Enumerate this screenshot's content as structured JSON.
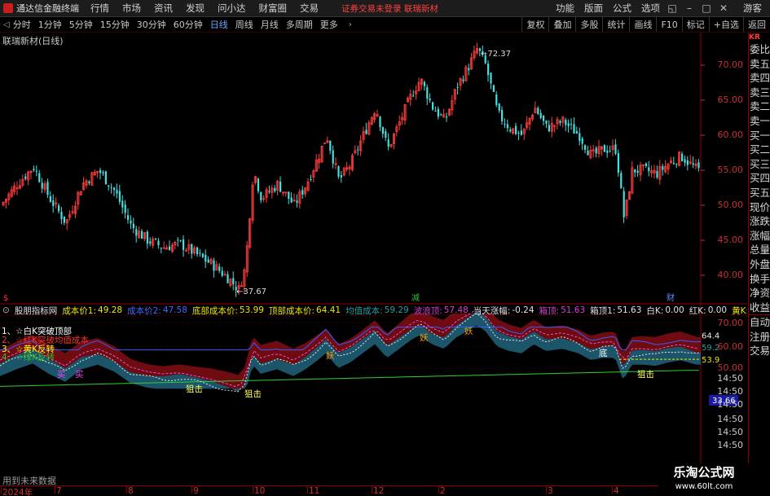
{
  "app": {
    "title": "通达信金融终端",
    "menu": [
      "行情",
      "市场",
      "资讯",
      "发现",
      "问小达",
      "财富圈",
      "交易"
    ],
    "notice": "证券交易未登录   联瑞新材",
    "right_menu": [
      "功能",
      "版面",
      "公式",
      "选项"
    ],
    "guest": "游客"
  },
  "toolbar": {
    "periods": [
      "分时",
      "1分钟",
      "5分钟",
      "15分钟",
      "30分钟",
      "60分钟",
      "日线",
      "周线",
      "月线",
      "多周期",
      "更多"
    ],
    "active_period": "日线",
    "right_buttons": [
      "复权",
      "叠加",
      "多股",
      "统计",
      "画线",
      "F10",
      "标记",
      "+自选",
      "返回"
    ]
  },
  "stock": {
    "title": "联瑞新材(日线)",
    "high_label": "72.37",
    "low_label": "37.67",
    "flags": [
      "$",
      "减",
      "财"
    ]
  },
  "price_axis": [
    "70.00",
    "65.00",
    "60.00",
    "55.00",
    "50.00",
    "45.00",
    "40.00"
  ],
  "sidebar": {
    "top": "KR",
    "items": [
      "委比",
      "卖五",
      "卖四",
      "卖三",
      "卖二",
      "卖一",
      "买一",
      "买二",
      "买三",
      "买四",
      "买五",
      "现价",
      "涨跌",
      "涨幅",
      "总量",
      "外盘",
      "换手",
      "净资",
      "收益",
      "自动",
      "注册",
      "交易"
    ]
  },
  "indicator": {
    "name": "股朋指标网",
    "fields": [
      {
        "label": "成本价1:",
        "value": "49.28",
        "color": "#e8e800"
      },
      {
        "label": "成本价2:",
        "value": "47.58",
        "color": "#3a6cff"
      },
      {
        "label": "底部成本价:",
        "value": "53.99",
        "color": "#e8e800"
      },
      {
        "label": "顶部成本价:",
        "value": "64.41",
        "color": "#e8e800"
      },
      {
        "label": "均值成本:",
        "value": "59.29",
        "color": "#20a0a0"
      },
      {
        "label": "波浪顶:",
        "value": "57.48",
        "color": "#d040d0"
      },
      {
        "label": "当天涨幅:",
        "value": "-0.24",
        "color": "#e0e0e0"
      },
      {
        "label": "箱顶:",
        "value": "51.63",
        "color": "#d040d0"
      },
      {
        "label": "箱顶1:",
        "value": "51.63",
        "color": "#e0e0e0"
      },
      {
        "label": "白K:",
        "value": "0.00",
        "color": "#e0e0e0"
      },
      {
        "label": "红K:",
        "value": "0.00",
        "color": "#e0e0e0"
      },
      {
        "label": "黄K:",
        "value": "0.00",
        "color": "#e8e800"
      },
      {
        "label": "绿K:",
        "value": "0.00",
        "color": "#e0e0e0"
      }
    ],
    "legend": [
      {
        "text": "1、☆白K突破顶部",
        "color": "#ffffff"
      },
      {
        "text": "2、☆红K突破均值成本",
        "color": "#ff3030"
      },
      {
        "text": "3、☆黄K反转",
        "color": "#ffff00"
      },
      {
        "text": "4、☆绿K反转",
        "color": "#30c030"
      }
    ],
    "axis": [
      "70.00",
      "60.00",
      "50.00",
      "14:50",
      "14:50",
      "14:50",
      "14:50",
      "14:50",
      "14:50"
    ],
    "right_tags": [
      "64.4",
      "59.2",
      "53.9"
    ],
    "current_tag": "33.66",
    "signals": [
      "买",
      "买",
      "狙击",
      "狙击",
      "狙击",
      "妖",
      "妖",
      "妖",
      "底"
    ]
  },
  "bottom_axis": [
    "2024年",
    "7",
    "8",
    "9",
    "10",
    "11",
    "12",
    "2",
    "3",
    "4",
    "5"
  ],
  "bottom_note": "用到未来数据",
  "watermark": {
    "title": "乐淘公式网",
    "url": "www.60lt.com"
  }
}
